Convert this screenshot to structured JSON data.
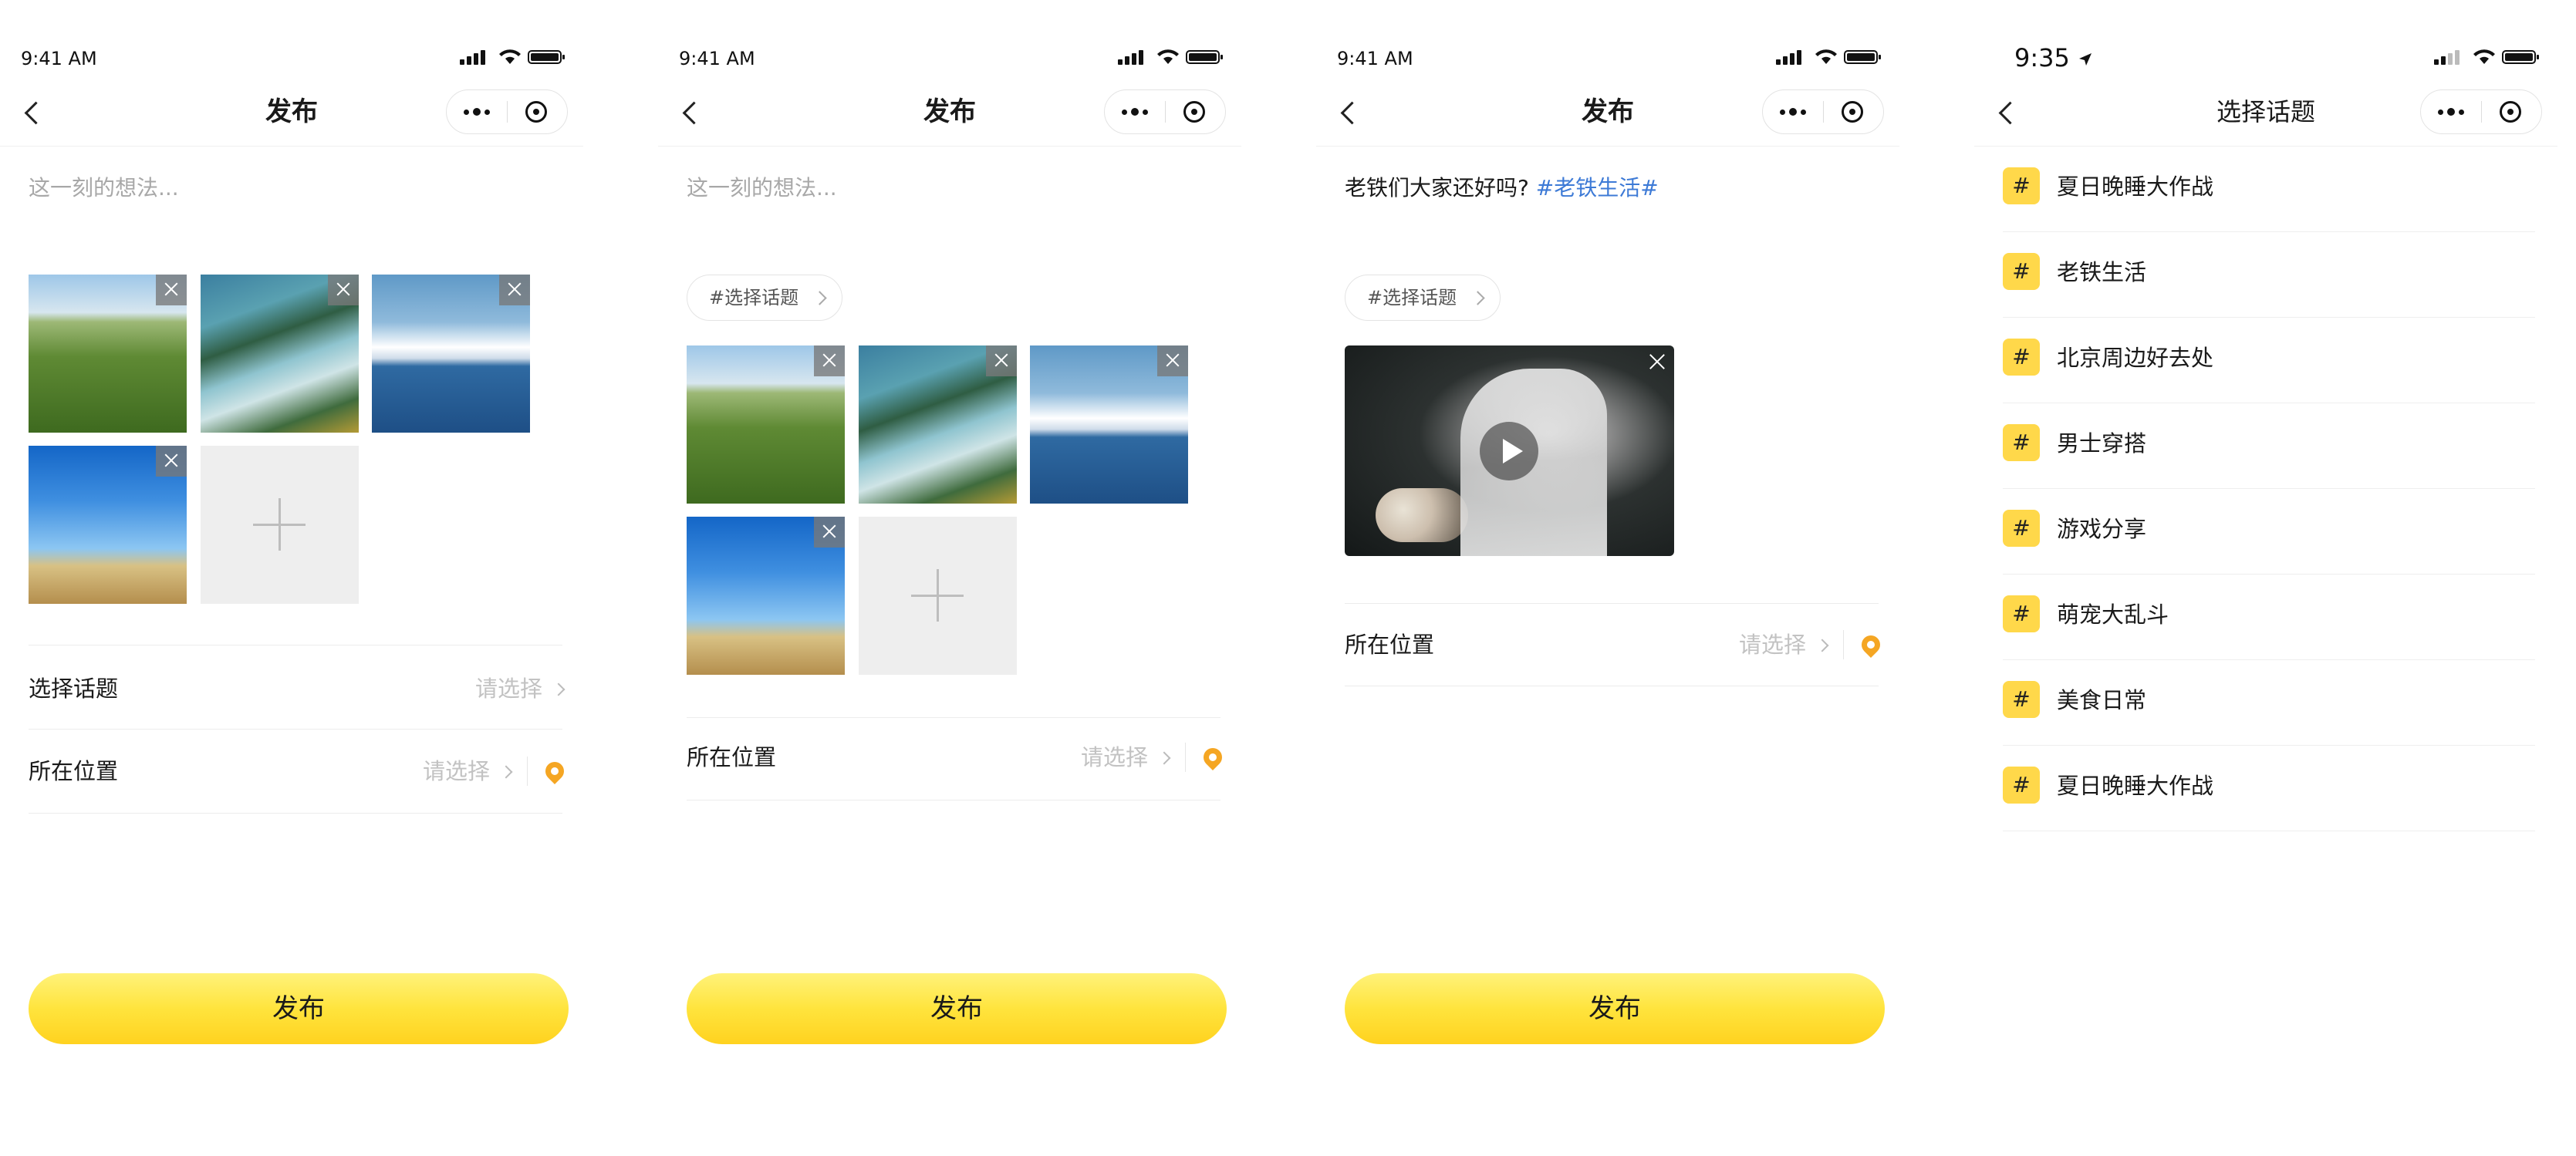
{
  "colors": {
    "accent_yellow": "#ffdc30",
    "hashtag_blue": "#3d7ad6",
    "pin_orange": "#f5a623",
    "placeholder_gray": "#a8a8a8"
  },
  "screens": [
    {
      "time": "9:41 AM",
      "title": "发布",
      "placeholder": "这一刻的想法...",
      "photos": [
        "field",
        "fjord",
        "mountain",
        "sky"
      ],
      "topic_row": {
        "label": "选择话题",
        "value": "请选择"
      },
      "location_row": {
        "label": "所在位置",
        "value": "请选择"
      },
      "submit": "发布"
    },
    {
      "time": "9:41 AM",
      "title": "发布",
      "placeholder": "这一刻的想法...",
      "topic_chip": "#选择话题",
      "photos": [
        "field",
        "fjord",
        "mountain",
        "sky"
      ],
      "location_row": {
        "label": "所在位置",
        "value": "请选择"
      },
      "submit": "发布"
    },
    {
      "time": "9:41 AM",
      "title": "发布",
      "text": "老铁们大家还好吗? ",
      "hashtag": "#老铁生活#",
      "topic_chip": "#选择话题",
      "location_row": {
        "label": "所在位置",
        "value": "请选择"
      },
      "submit": "发布"
    },
    {
      "time": "9:35",
      "title": "选择话题",
      "hash_symbol": "#",
      "topics": [
        "夏日晚睡大作战",
        "老铁生活",
        "北京周边好去处",
        "男士穿搭",
        "游戏分享",
        "萌宠大乱斗",
        "美食日常",
        "夏日晚睡大作战"
      ]
    }
  ]
}
